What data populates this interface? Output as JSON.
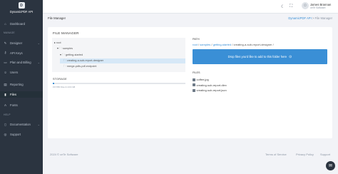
{
  "sidebar": {
    "brand": {
      "logo_text": "D",
      "name": "DynamicPDF API"
    },
    "sections": {
      "manage": "MANAGE",
      "help": "HELP"
    },
    "items": [
      {
        "label": "Dashboard",
        "icon": "dashboard-icon"
      },
      {
        "label": "Designer",
        "icon": "designer-icon",
        "has_chevron": true
      },
      {
        "label": "API Keys",
        "icon": "key-icon"
      },
      {
        "label": "Plan and Billing",
        "icon": "billing-icon",
        "has_chevron": true
      },
      {
        "label": "Users",
        "icon": "users-icon"
      },
      {
        "label": "Reporting",
        "icon": "reporting-icon"
      },
      {
        "label": "Files",
        "icon": "files-icon",
        "active": true
      },
      {
        "label": "Fonts",
        "icon": "fonts-icon"
      },
      {
        "label": "Documentation",
        "icon": "documentation-icon",
        "has_chevron": true
      },
      {
        "label": "Support",
        "icon": "support-icon"
      }
    ]
  },
  "topbar": {
    "user_name": "James Brannan",
    "user_org": "ceTe Software",
    "icons": [
      "moon-icon",
      "fullscreen-icon",
      "user-avatar-icon"
    ]
  },
  "page": {
    "title": "File Manager",
    "breadcrumb": {
      "root": "DynamicPDF API",
      "separator": ">",
      "current": "File Manager"
    }
  },
  "file_manager": {
    "title": "FILE MANAGER",
    "tree": [
      {
        "label": "root",
        "glyph": "▸"
      },
      {
        "label": "samples",
        "glyph": "▾ 🗀"
      },
      {
        "label": "getting-started",
        "glyph": "▾ 🗀"
      },
      {
        "label": "creating-a-sub-report-designer",
        "glyph": "🗀"
      },
      {
        "label": "merge-pdfs-pdf-endpoint",
        "glyph": "🗀"
      }
    ],
    "storage": {
      "label": "STORAGE",
      "usage_text": "157/256 Files & 4.0/4 GB",
      "used_fraction": 0.01
    },
    "path": {
      "label": "PATH",
      "segments": [
        "root",
        "samples",
        "getting-started"
      ],
      "separator": "/",
      "current": "creating-a-sub-report-designer",
      "trailing": "/"
    },
    "dropzone_text": "Drop files you'd like to add to this folder here",
    "files_label": "FILES",
    "files": [
      "coffee.jpg",
      "creating-sub-report.dlex",
      "creating-sub-report.json"
    ]
  },
  "footer": {
    "copyright": "2024 © ceTe Software",
    "links": [
      "Terms of Service",
      "Privacy Policy",
      "Support"
    ]
  }
}
